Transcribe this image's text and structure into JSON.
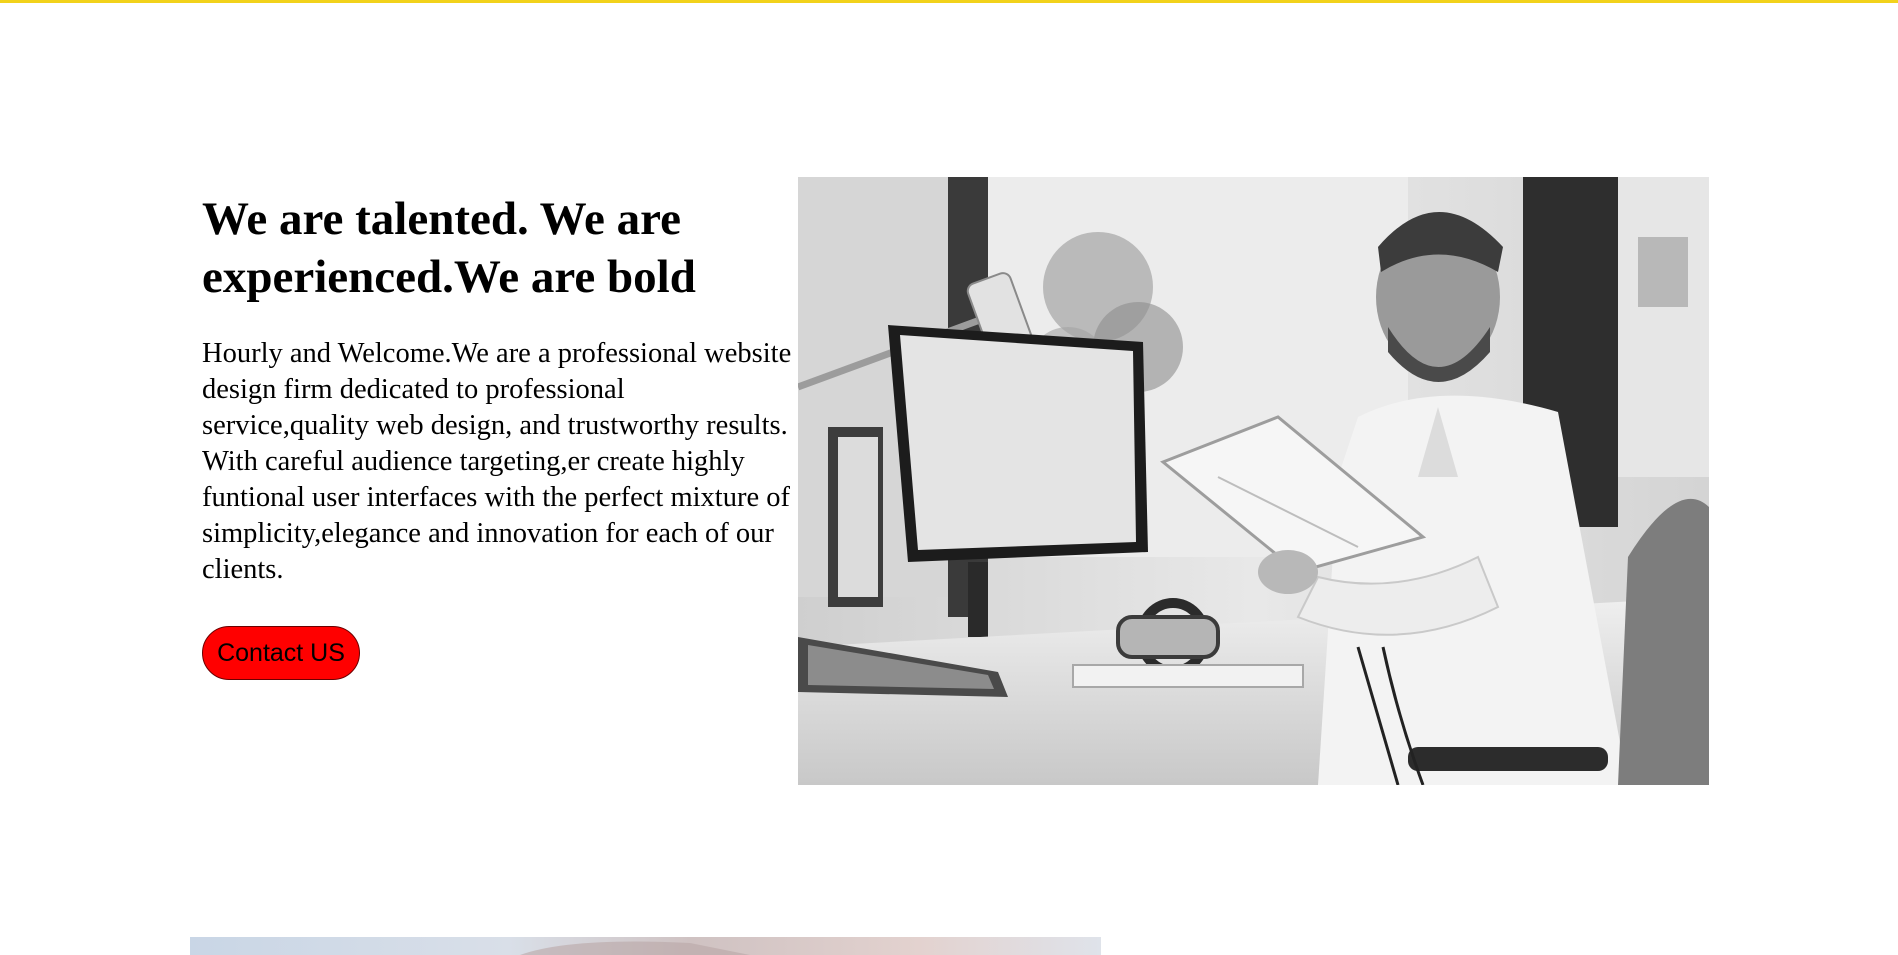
{
  "theme": {
    "top_rule_color": "#f2d21b",
    "button_color": "#ff0000"
  },
  "about": {
    "headline": "We are talented. We are experienced.We are bold",
    "body": "Hourly and Welcome.We are a professional website design firm dedicated to professional service,quality web design, and trustworthy results. With careful audience targeting,er create highly funtional user interfaces with the perfect mixture of simplicity,elegance and innovation for each of our clients.",
    "cta_label": "Contact US"
  },
  "images": {
    "hero": "grayscale-man-at-desk-holding-book-photo",
    "next": "cropped-photo-top-edge"
  }
}
